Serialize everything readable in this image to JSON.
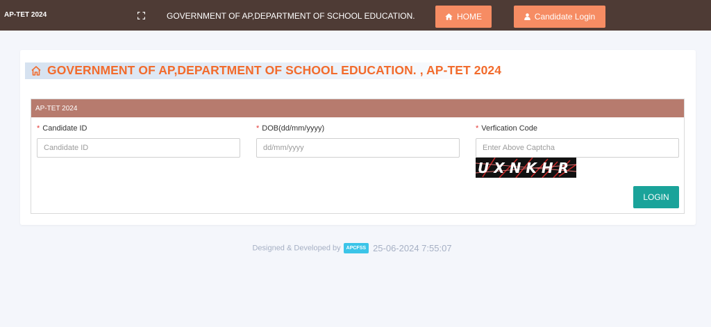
{
  "header": {
    "brand": "AP-TET 2024",
    "title": "GOVERNMENT OF AP,DEPARTMENT OF SCHOOL EDUCATION.",
    "home_label": "HOME",
    "candidate_login_label": "Candidate Login"
  },
  "page": {
    "heading": "GOVERNMENT OF AP,DEPARTMENT OF SCHOOL EDUCATION. , AP-TET 2024"
  },
  "form": {
    "panel_title": "AP-TET 2024",
    "candidate_id_label": "Candidate ID",
    "candidate_id_placeholder": "Candidate ID",
    "dob_label": "DOB(dd/mm/yyyy)",
    "dob_placeholder": "dd/mm/yyyy",
    "verification_label": "Verfication Code",
    "verification_placeholder": "Enter Above Captcha",
    "captcha_text": "UXNKHR",
    "required_mark": "*",
    "login_label": "LOGIN"
  },
  "footer": {
    "designed_by": "Designed & Developed by",
    "badge": "APCFSS",
    "datetime": "25-06-2024 7:55:07"
  },
  "colors": {
    "topbar": "#4e3b35",
    "nav_button": "#f68c63",
    "heading": "#f26b2c",
    "panel_header": "#b77b6e",
    "login_button": "#1aa39a"
  },
  "icons": {
    "fullscreen": "expand-icon",
    "home": "home-icon",
    "candidate": "user-icon",
    "heading": "home-outline-icon"
  }
}
